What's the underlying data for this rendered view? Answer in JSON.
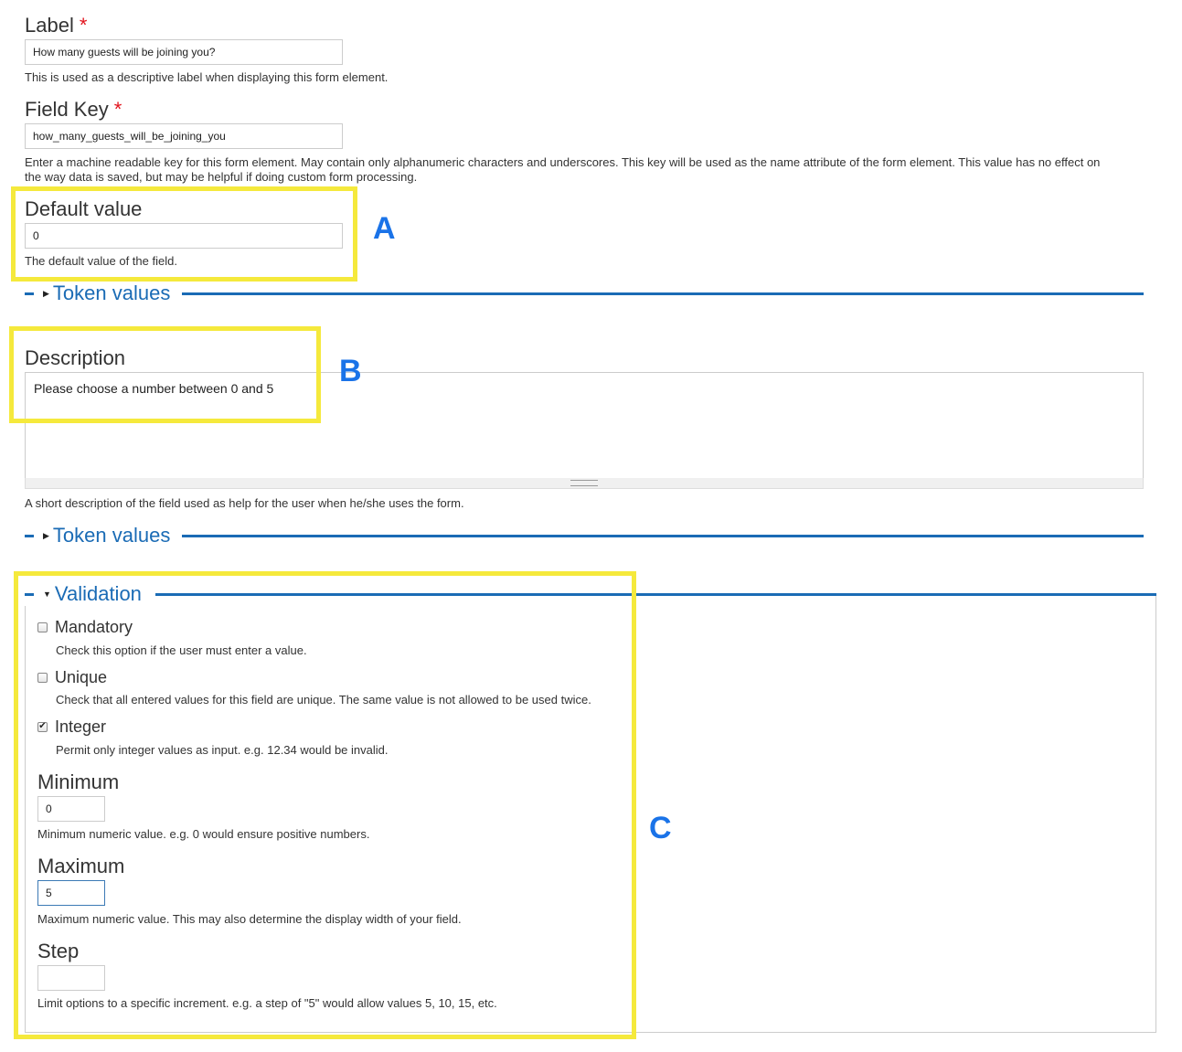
{
  "label_field": {
    "label": "Label",
    "required_mark": "*",
    "value": "How many guests will be joining you?",
    "help": "This is used as a descriptive label when displaying this form element."
  },
  "field_key": {
    "label": "Field Key",
    "required_mark": "*",
    "value": "how_many_guests_will_be_joining_you",
    "help_line1": "Enter a machine readable key for this form element. May contain only alphanumeric characters and underscores. This key will be used as the name attribute of the form element. This value has no effect on",
    "help_line2": "the way data is saved, but may be helpful if doing custom form processing."
  },
  "default_value": {
    "label": "Default value",
    "value": "0",
    "help": "The default value of the field."
  },
  "token_values_1": {
    "title": "Token values",
    "arrow_icon": "triangle-right"
  },
  "description": {
    "label": "Description",
    "value": "Please choose a number between 0 and 5",
    "help": "A short description of the field used as help for the user when he/she uses the form."
  },
  "token_values_2": {
    "title": "Token values",
    "arrow_icon": "triangle-right"
  },
  "validation": {
    "title": "Validation",
    "arrow_icon": "triangle-down",
    "mandatory": {
      "label": "Mandatory",
      "checked": false,
      "help": "Check this option if the user must enter a value."
    },
    "unique": {
      "label": "Unique",
      "checked": false,
      "help": "Check that all entered values for this field are unique. The same value is not allowed to be used twice."
    },
    "integer": {
      "label": "Integer",
      "checked": true,
      "help": "Permit only integer values as input. e.g. 12.34 would be invalid."
    },
    "minimum": {
      "label": "Minimum",
      "value": "0",
      "help": "Minimum numeric value. e.g. 0 would ensure positive numbers."
    },
    "maximum": {
      "label": "Maximum",
      "value": "5",
      "help": "Maximum numeric value. This may also determine the display width of your field."
    },
    "step": {
      "label": "Step",
      "value": "",
      "help": "Limit options to a specific increment. e.g. a step of \"5\" would allow values 5, 10, 15, etc."
    }
  },
  "annotations": {
    "a": "A",
    "b": "B",
    "c": "C"
  },
  "colors": {
    "accent": "#1a6bb5",
    "highlight": "#f5e93c",
    "annotation": "#1a73e8",
    "required": "#e2141d"
  }
}
